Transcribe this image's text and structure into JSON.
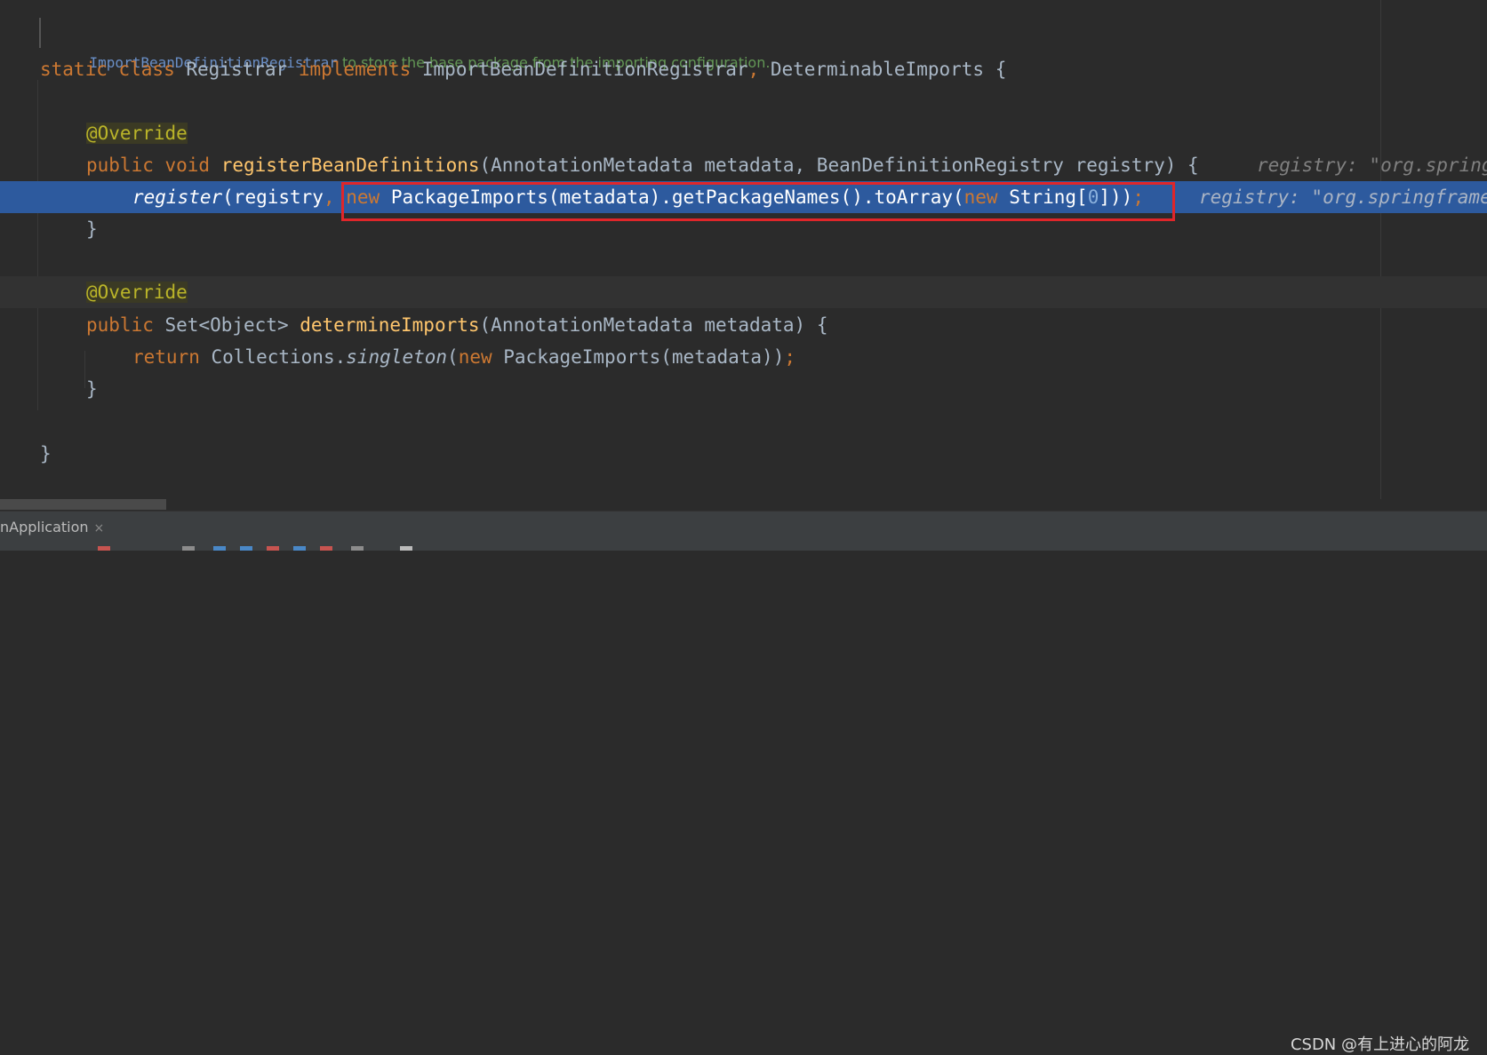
{
  "doc_comment": {
    "link": "ImportBeanDefinitionRegistrar",
    "text": " to store the base package from the importing configuration."
  },
  "code": {
    "l1": {
      "kw1": "static class ",
      "name": "Registrar ",
      "kw2": "implements ",
      "iface1": "ImportBeanDefinitionRegistrar",
      "comma": ", ",
      "iface2": "DeterminableImports {"
    },
    "l2": {
      "annotation": "@Override"
    },
    "l3": {
      "kw": "public void ",
      "fn": "registerBeanDefinitions",
      "params": "(AnnotationMetadata metadata, BeanDefinitionRegistry registry) {",
      "hint": "registry: \"org.springframework"
    },
    "l4": {
      "call": "register",
      "args1": "(registry",
      "comma": ", ",
      "kw_new": "new ",
      "expr": "PackageImports(metadata).getPackageNames().toArray(",
      "kw_new2": "new ",
      "type": "String[",
      "num": "0",
      "close": "]))",
      "semi": ";",
      "hint": "registry: \"org.springframework"
    },
    "l5": {
      "brace": "}"
    },
    "l6": {
      "annotation": "@Override"
    },
    "l7": {
      "kw": "public ",
      "type": "Set<Object> ",
      "fn": "determineImports",
      "params": "(AnnotationMetadata metadata) {"
    },
    "l8": {
      "kw": "return ",
      "cls": "Collections.",
      "call": "singleton",
      "open": "(",
      "kw_new": "new ",
      "expr": "PackageImports(metadata))",
      "semi": ";"
    },
    "l9": {
      "brace": "}"
    },
    "l10": {
      "brace": "}"
    }
  },
  "tabs": [
    {
      "label": "nApplication",
      "close": "×"
    }
  ],
  "watermark": "CSDN @有上进心的阿龙",
  "colors": {
    "background": "#2b2b2b",
    "keyword": "#cc7832",
    "function": "#ffc66d",
    "annotation": "#bbb529",
    "highlight_line": "#2d5a9e",
    "red_box": "#e0262a"
  }
}
